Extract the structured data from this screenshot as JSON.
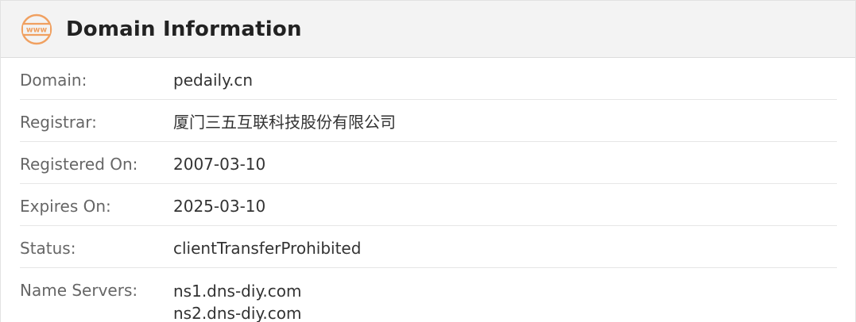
{
  "header": {
    "icon": "www-globe-icon",
    "title": "Domain Information",
    "accent_color": "#f0a060"
  },
  "rows": {
    "domain": {
      "label": "Domain:",
      "value": "pedaily.cn"
    },
    "registrar": {
      "label": "Registrar:",
      "value": "厦门三五互联科技股份有限公司"
    },
    "registered_on": {
      "label": "Registered On:",
      "value": "2007-03-10"
    },
    "expires_on": {
      "label": "Expires On:",
      "value": "2025-03-10"
    },
    "status": {
      "label": "Status:",
      "value": "clientTransferProhibited"
    },
    "name_servers": {
      "label": "Name Servers:",
      "values": [
        "ns1.dns-diy.com",
        "ns2.dns-diy.com"
      ]
    }
  }
}
